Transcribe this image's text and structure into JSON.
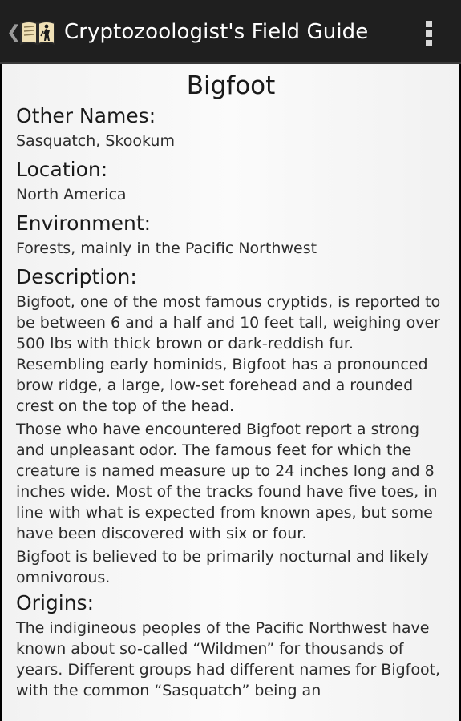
{
  "action_bar": {
    "title": "Cryptozoologist's Field Guide",
    "up_icon": "chevron-left-icon",
    "app_icon": "field-guide-book-icon",
    "overflow_icon": "overflow-menu-icon"
  },
  "entry": {
    "title": "Bigfoot",
    "sections": {
      "other_names": {
        "heading": "Other Names:",
        "value": "Sasquatch, Skookum"
      },
      "location": {
        "heading": "Location:",
        "value": "North America"
      },
      "environment": {
        "heading": "Environment:",
        "value": "Forests, mainly in the Pacific Northwest"
      },
      "description": {
        "heading": "Description:",
        "paragraphs": [
          "Bigfoot, one of the most famous cryptids, is reported to be between 6 and a half and 10 feet tall, weighing over 500 lbs with thick brown or dark-reddish fur. Resembling early hominids, Bigfoot has a pronounced brow ridge, a large, low-set forehead and a rounded crest on the top of the head.",
          "Those who have encountered Bigfoot report a strong and unpleasant odor. The famous feet for which the creature is named measure up to 24 inches long and 8 inches wide.  Most of the tracks found have five toes, in line with what is expected from known apes, but some have been discovered with six or four.",
          "Bigfoot is believed to be primarily nocturnal and likely omnivorous."
        ]
      },
      "origins": {
        "heading": "Origins:",
        "paragraphs": [
          "The indigineous peoples of the Pacific Northwest have known about so-called “Wildmen” for thousands of years.  Different groups had different names for Bigfoot, with the common “Sasquatch” being an"
        ]
      }
    }
  },
  "colors": {
    "action_bar": "#1f1f1f",
    "content_background": "#f7f7f7",
    "title_text": "#ffffff",
    "body_text": "#2c2c2c"
  }
}
